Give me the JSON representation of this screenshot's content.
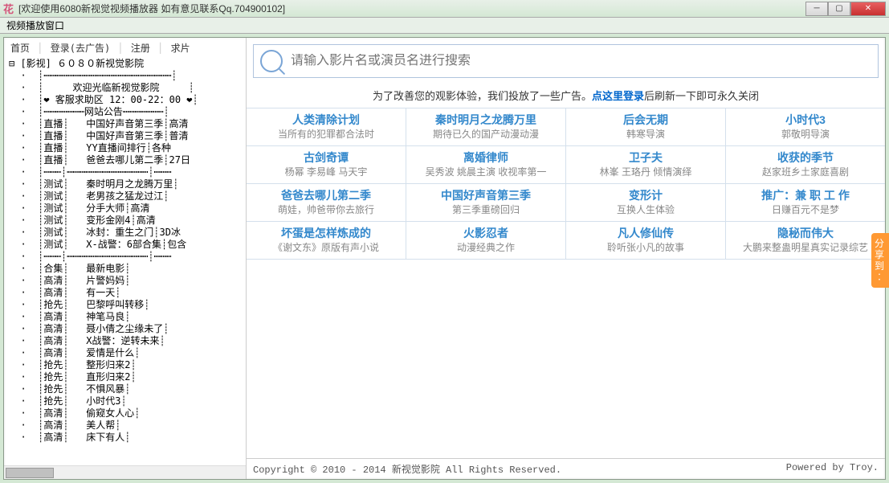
{
  "window": {
    "logo": "花",
    "title": "[欢迎使用6080新视觉视频播放器 如有意见联系Qq.704900102]"
  },
  "menubar": {
    "label": "视频播放窗口"
  },
  "topnav": {
    "home": "首页",
    "login": "登录(去广告)",
    "register": "注册",
    "request": "求片"
  },
  "tree": {
    "root": "⊟ [影视] ６０８０新视觉影院",
    "banner1": "欢迎光临新视觉影院",
    "banner2": "❤ 客服求助区 12：00-22：00 ❤",
    "banner3": "网站公告",
    "bcast": [
      {
        "tag": "直播",
        "name": "中国好声音第三季",
        "ext": "高清"
      },
      {
        "tag": "直播",
        "name": "中国好声音第三季",
        "ext": "普清"
      },
      {
        "tag": "直播",
        "name": "YY直播间排行",
        "ext": "各种"
      },
      {
        "tag": "直播",
        "name": "爸爸去哪儿第二季",
        "ext": "27日"
      }
    ],
    "test": [
      {
        "tag": "测试",
        "name": "秦时明月之龙腾万里",
        "ext": ""
      },
      {
        "tag": "测试",
        "name": "老男孩之猛龙过江",
        "ext": ""
      },
      {
        "tag": "测试",
        "name": "分手大师",
        "ext": "高清"
      },
      {
        "tag": "测试",
        "name": "变形金刚4",
        "ext": "高清"
      },
      {
        "tag": "测试",
        "name": "冰封：重生之门",
        "ext": "3D冰"
      },
      {
        "tag": "测试",
        "name": "X-战警：6部合集",
        "ext": "包含"
      }
    ],
    "list": [
      {
        "tag": "合集",
        "name": "最新电影",
        "ext": ""
      },
      {
        "tag": "高清",
        "name": "片警妈妈",
        "ext": ""
      },
      {
        "tag": "高清",
        "name": "有一天",
        "ext": ""
      },
      {
        "tag": "抢先",
        "name": "巴黎呼叫转移",
        "ext": ""
      },
      {
        "tag": "高清",
        "name": "神笔马良",
        "ext": ""
      },
      {
        "tag": "高清",
        "name": "聂小倩之尘缘未了",
        "ext": ""
      },
      {
        "tag": "高清",
        "name": "X战警：逆转未来",
        "ext": ""
      },
      {
        "tag": "高清",
        "name": "爱情是什么",
        "ext": ""
      },
      {
        "tag": "抢先",
        "name": "整形归来2",
        "ext": ""
      },
      {
        "tag": "抢先",
        "name": "直形归来2",
        "ext": ""
      },
      {
        "tag": "抢先",
        "name": "不惧风暴",
        "ext": ""
      },
      {
        "tag": "抢先",
        "name": "小时代3",
        "ext": ""
      },
      {
        "tag": "高清",
        "name": "偷窥女人心",
        "ext": ""
      },
      {
        "tag": "高清",
        "name": "美人帮",
        "ext": ""
      },
      {
        "tag": "高清",
        "name": "床下有人",
        "ext": ""
      }
    ]
  },
  "search": {
    "placeholder": "请输入影片名或演员名进行搜索"
  },
  "notice": {
    "pre": "为了改善您的观影体验，我们投放了一些广告。",
    "link": "点这里登录",
    "post": "后刷新一下即可永久关闭"
  },
  "grid": [
    [
      {
        "t": "人类清除计划",
        "s": "当所有的犯罪都合法时"
      },
      {
        "t": "秦时明月之龙腾万里",
        "s": "期待已久的国产动漫动漫"
      },
      {
        "t": "后会无期",
        "s": "韩寒导演"
      },
      {
        "t": "小时代3",
        "s": "郭敬明导演"
      }
    ],
    [
      {
        "t": "古剑奇谭",
        "s": "杨幂 李易峰 马天宇"
      },
      {
        "t": "离婚律师",
        "s": "吴秀波 姚晨主演 收视率第一"
      },
      {
        "t": "卫子夫",
        "s": "林峯 王珞丹 倾情演绎"
      },
      {
        "t": "收获的季节",
        "s": "赵家班乡土家庭喜剧"
      }
    ],
    [
      {
        "t": "爸爸去哪儿第二季",
        "s": "萌娃，帅爸带你去旅行"
      },
      {
        "t": "中国好声音第三季",
        "s": "第三季重磅回归"
      },
      {
        "t": "变形计",
        "s": "互换人生体验"
      },
      {
        "t": "推广：兼 职 工 作",
        "s": "日赚百元不是梦"
      }
    ],
    [
      {
        "t": "坏蛋是怎样炼成的",
        "s": "《谢文东》原版有声小说"
      },
      {
        "t": "火影忍者",
        "s": "动漫经典之作"
      },
      {
        "t": "凡人修仙传",
        "s": "聆听张小凡的故事"
      },
      {
        "t": "隐秘而伟大",
        "s": "大鹏来整蛊明星真实记录综艺"
      }
    ]
  ],
  "footer": {
    "copyright": "Copyright © 2010 - 2014 新视觉影院 All Rights Reserved.",
    "powered": "Powered by Troy."
  },
  "share": "分享到："
}
